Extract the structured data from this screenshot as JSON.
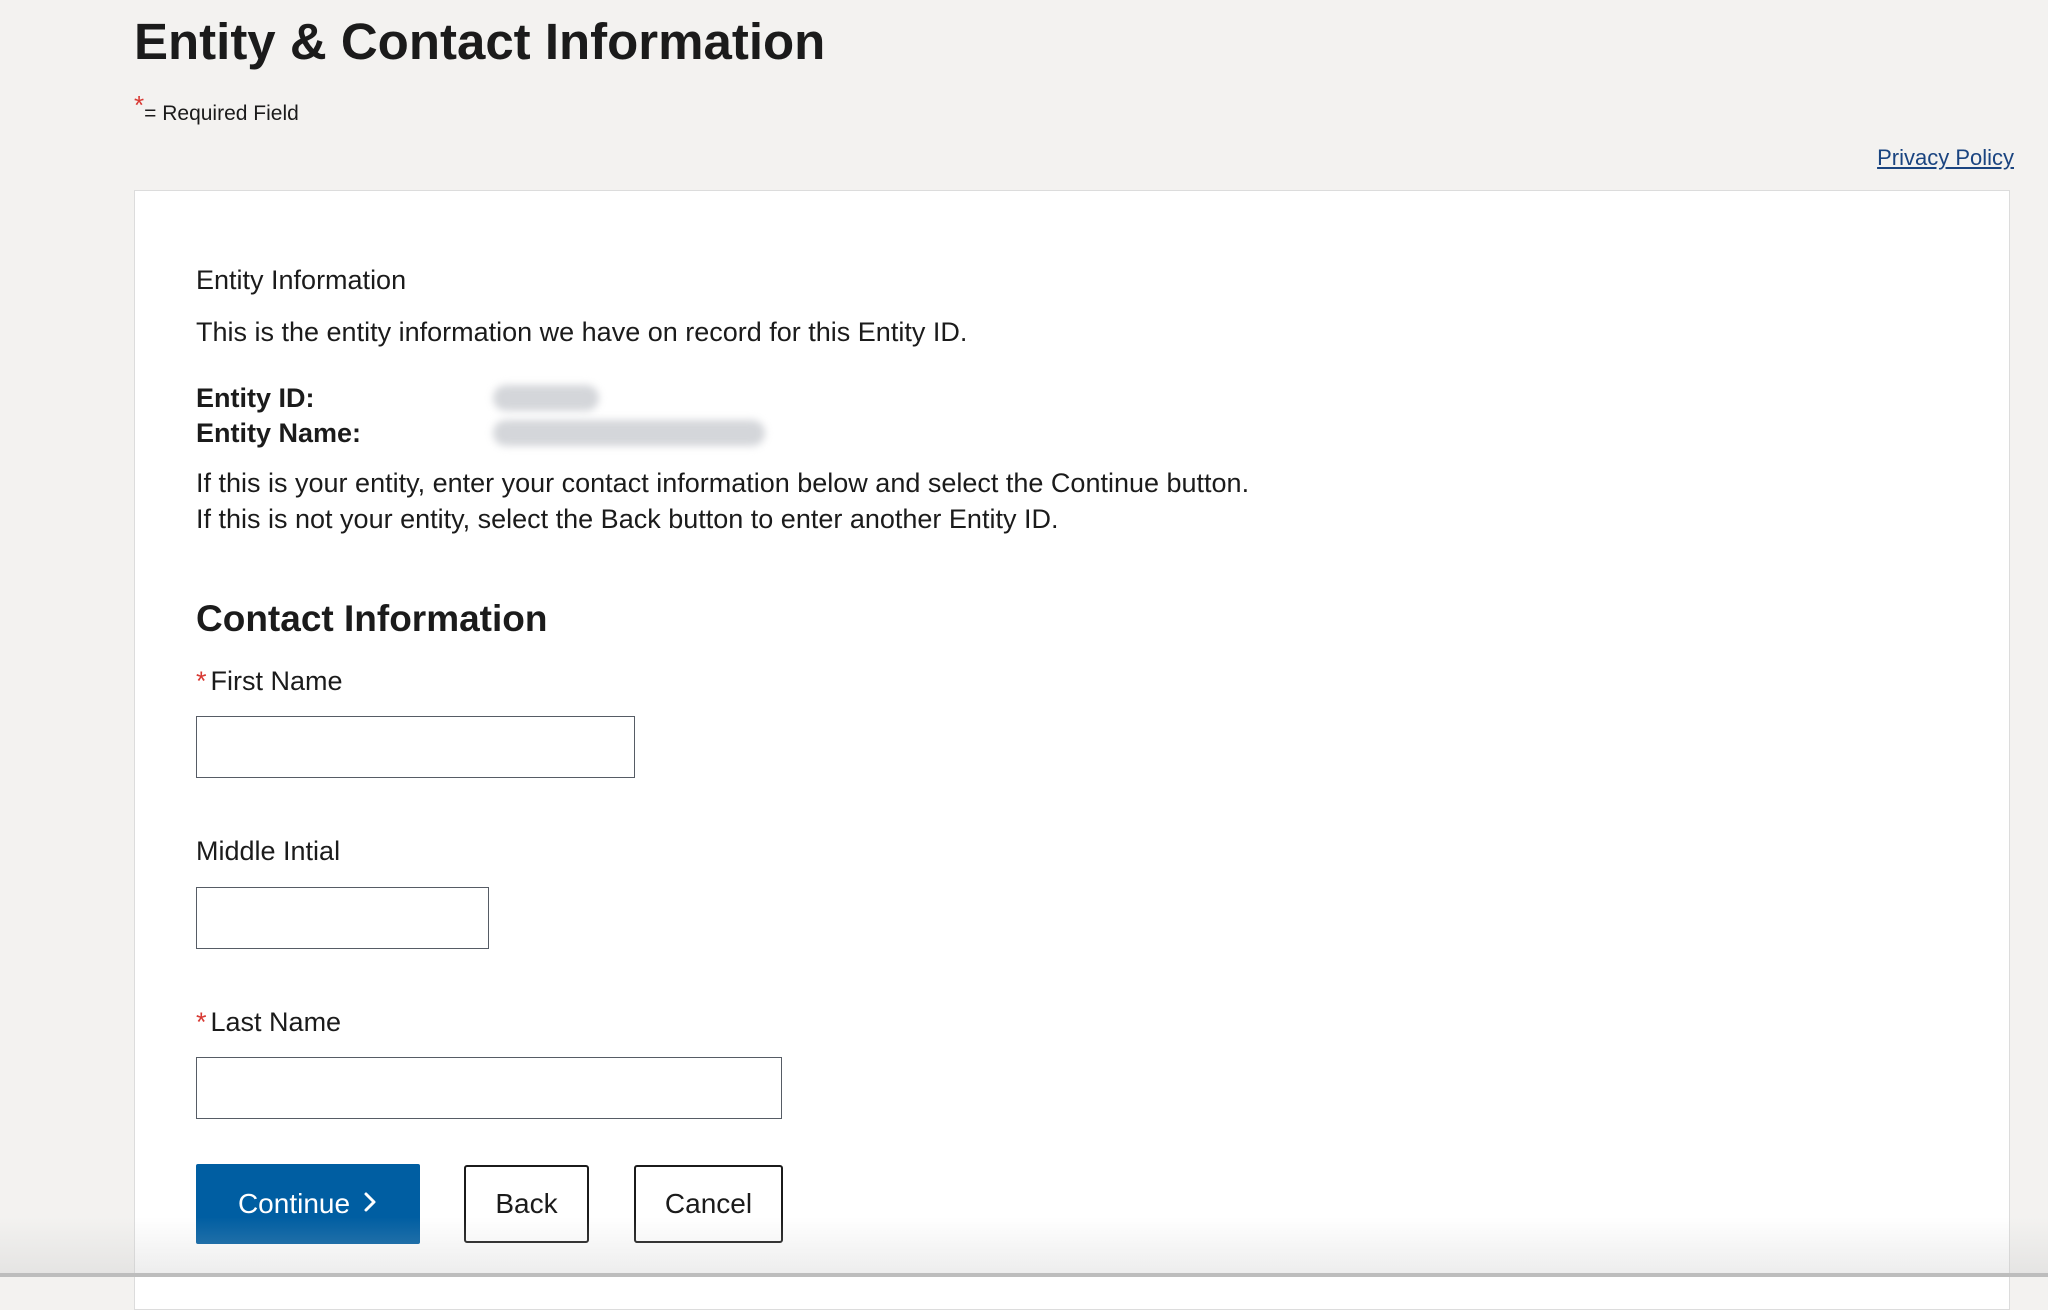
{
  "page": {
    "title": "Entity & Contact Information",
    "required_star": "*",
    "required_legend": "= Required Field",
    "privacy_link": "Privacy Policy"
  },
  "entity": {
    "section_label": "Entity Information",
    "intro": "This is the entity information we have on record for this Entity ID.",
    "id_label": "Entity ID:",
    "name_label": "Entity Name:",
    "instructions": [
      "If this is your entity, enter your contact information below and select the Continue button.",
      "If this is not your entity, select the Back button to enter another Entity ID."
    ]
  },
  "contact": {
    "heading": "Contact Information",
    "first_name": {
      "label": "First Name",
      "required": true,
      "value": ""
    },
    "middle_initial": {
      "label": "Middle Intial",
      "required": false,
      "value": ""
    },
    "last_name": {
      "label": "Last Name",
      "required": true,
      "value": ""
    }
  },
  "actions": {
    "continue_label": "Continue",
    "continue_icon": "chevron-right-icon",
    "back_label": "Back",
    "cancel_label": "Cancel"
  },
  "colors": {
    "primary": "#005ea2",
    "required": "#d83933",
    "link": "#1a4480",
    "page_bg": "#f3f2f0"
  }
}
